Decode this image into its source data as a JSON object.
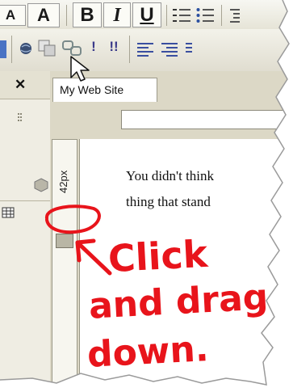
{
  "toolbar": {
    "font_size_down": "A",
    "font_size_up": "A",
    "bold": "B",
    "italic": "I",
    "underline": "U",
    "marker_single": "!",
    "marker_double": "!!"
  },
  "editor": {
    "tab_title": "My Web Site",
    "ruler_label": "42px",
    "content_lines": [
      "You didn't think",
      "thing that stand"
    ]
  },
  "annotation": {
    "line1": "Click",
    "line2": "and drag",
    "line3": "down."
  },
  "colors": {
    "annotation": "#e8141b",
    "toolbar_bg": "#ece9d8"
  },
  "icons": [
    "close-icon",
    "globe-icon",
    "copy-icon",
    "link-icon",
    "align-left-icon",
    "align-right-icon",
    "list-bullets-icon",
    "list-numbered-icon",
    "mouse-cursor-icon",
    "arrow-annotation-icon"
  ]
}
